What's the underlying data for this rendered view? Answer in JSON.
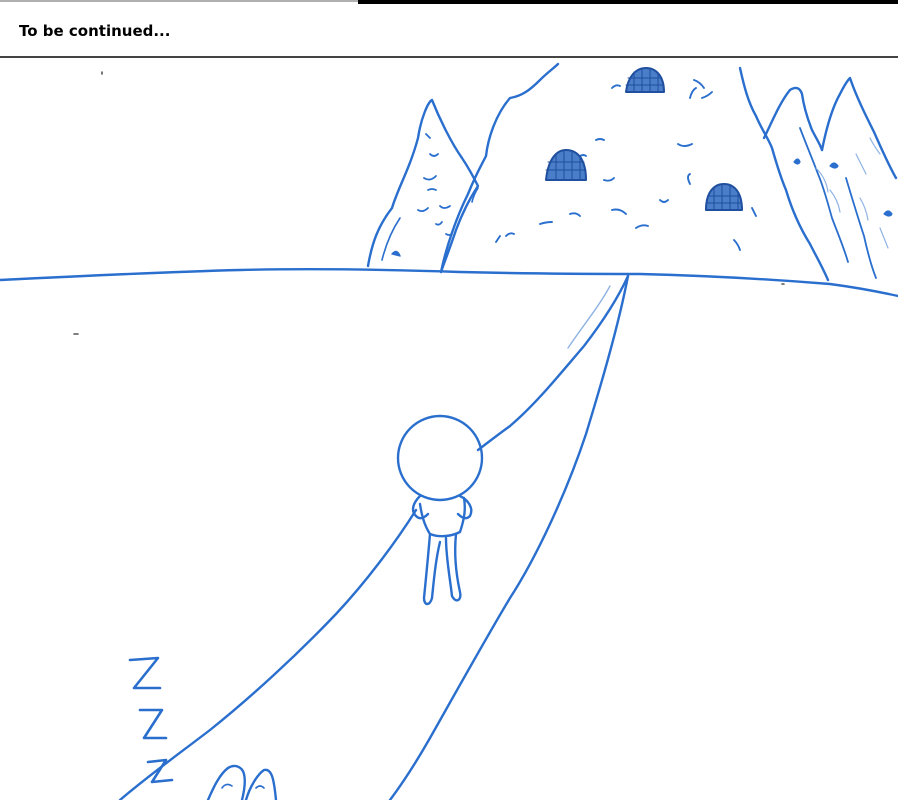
{
  "caption": {
    "text": "To be continued..."
  },
  "drawing": {
    "ink_color": "#2a6fce",
    "dark_ink_color": "#1f4f9e",
    "paper_color": "#ffffff",
    "elements": [
      "mountains",
      "horizon",
      "path",
      "person",
      "sleep-z",
      "ghost-figures"
    ],
    "sleep_glyphs": [
      "Z",
      "Z",
      "Z"
    ]
  }
}
